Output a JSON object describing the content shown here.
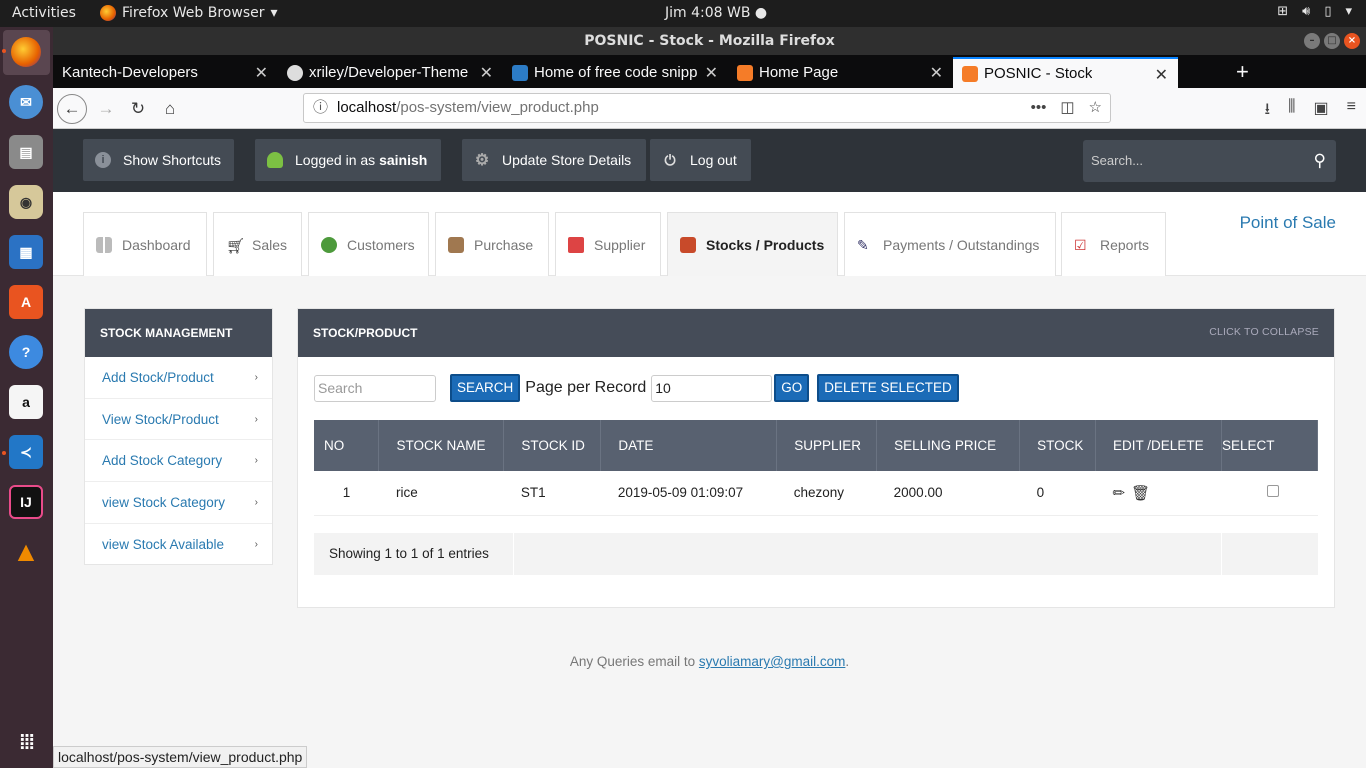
{
  "system": {
    "activities": "Activities",
    "app_menu": "Firefox Web Browser",
    "clock": "Jim  4:08 WB"
  },
  "window": {
    "title": "POSNIC - Stock - Mozilla Firefox"
  },
  "browser": {
    "tabs": [
      {
        "label": "Kantech-Developers",
        "favicon": "none"
      },
      {
        "label": "xriley/Developer-Theme",
        "favicon": "github-icon"
      },
      {
        "label": "Home of free code snipp",
        "favicon": "bootsnipp-icon"
      },
      {
        "label": "Home Page",
        "favicon": "xampp-icon"
      },
      {
        "label": "POSNIC - Stock",
        "favicon": "xampp-icon"
      }
    ],
    "url_host": "localhost",
    "url_path": "/pos-system/view_product.php",
    "status_url": "localhost/pos-system/view_product.php"
  },
  "header": {
    "shortcuts": "Show Shortcuts",
    "logged_prefix": "Logged in as",
    "username": "sainish",
    "update_store": "Update Store Details",
    "logout": "Log out",
    "search_placeholder": "Search..."
  },
  "nav": {
    "tabs": [
      "Dashboard",
      "Sales",
      "Customers",
      "Purchase",
      "Supplier",
      "Stocks / Products",
      "Payments / Outstandings",
      "Reports"
    ],
    "active_tab": "Stocks / Products",
    "brand": "Point of Sale"
  },
  "sidebar": {
    "title": "STOCK MANAGEMENT",
    "items": [
      "Add Stock/Product",
      "View Stock/Product",
      "Add Stock Category",
      "view Stock Category",
      "view Stock Available"
    ]
  },
  "panel": {
    "title": "STOCK/PRODUCT",
    "collapse": "CLICK TO COLLAPSE",
    "search_placeholder": "Search",
    "search_btn": "SEARCH",
    "per_page_label": "Page per Record",
    "per_page_value": "10",
    "go_btn": "GO",
    "delete_btn": "DELETE SELECTED",
    "columns": [
      "NO",
      "STOCK NAME",
      "STOCK ID",
      "DATE",
      "SUPPLIER",
      "SELLING PRICE",
      "STOCK",
      "EDIT /DELETE",
      "SELECT"
    ],
    "rows": [
      {
        "no": "1",
        "name": "rice",
        "id": "ST1",
        "date": "2019-05-09 01:09:07",
        "supplier": "chezony",
        "price": "2000.00",
        "stock": "0"
      }
    ],
    "entries_info": "Showing 1 to 1 of 1 entries"
  },
  "footer": {
    "prefix": "Any Queries email to",
    "email": "syvoliamary@gmail.com",
    "suffix": "."
  },
  "colors": {
    "header_bg": "#2e3339",
    "panel_head": "#454c58",
    "table_head": "#586170",
    "link": "#2a7ab0",
    "button": "#1b6bb7"
  }
}
